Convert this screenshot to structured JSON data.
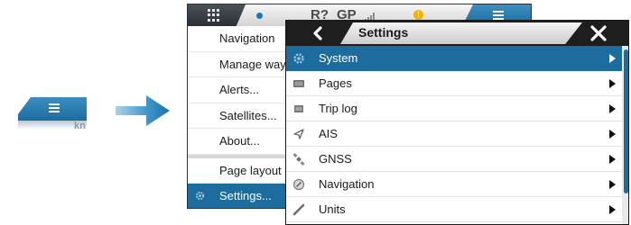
{
  "mini_button": {
    "label_partial": "kn",
    "icon": "menu-icon"
  },
  "arrow": {
    "icon": "arrow-right-icon"
  },
  "status_bar": {
    "radar_status": "R?",
    "gps_status": "GP",
    "signal_icon": "signal-bars-icon",
    "alert_icon": "!",
    "apps_icon": "grid-icon",
    "menu_icon": "menu-icon"
  },
  "menu": {
    "items": [
      {
        "label": "Navigation"
      },
      {
        "label": "Manage waypo"
      },
      {
        "label": "Alerts..."
      },
      {
        "label": "Satellites..."
      },
      {
        "label": "About..."
      },
      {
        "label": "Page layout"
      },
      {
        "label": "Settings...",
        "selected": true,
        "icon": "gear-icon"
      }
    ]
  },
  "settings": {
    "title": "Settings",
    "back_icon": "chevron-left-icon",
    "close_icon": "close-icon",
    "rows": [
      {
        "label": "System",
        "icon": "gear-icon",
        "selected": true
      },
      {
        "label": "Pages",
        "icon": "pages-icon"
      },
      {
        "label": "Trip log",
        "icon": "trip-log-icon"
      },
      {
        "label": "AIS",
        "icon": "ais-icon"
      },
      {
        "label": "GNSS",
        "icon": "satellite-icon"
      },
      {
        "label": "Navigation",
        "icon": "compass-icon"
      },
      {
        "label": "Units",
        "icon": "ruler-icon"
      }
    ]
  },
  "colors": {
    "accent": "#1c6c9e",
    "title_bar": "#1e1e1e",
    "alert": "#f0b400"
  }
}
